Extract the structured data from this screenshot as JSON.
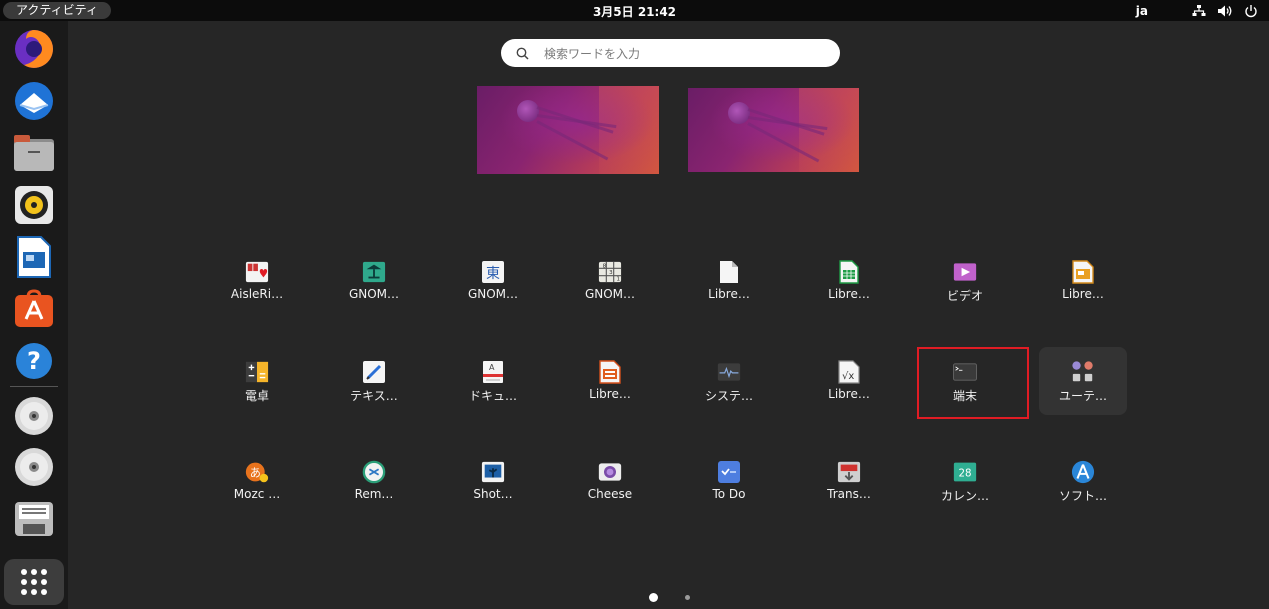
{
  "topbar": {
    "activities": "アクティビティ",
    "clock": "3月5日  21:42",
    "lang": "ja",
    "icons": [
      "network-icon",
      "volume-icon",
      "power-icon"
    ]
  },
  "dock": {
    "items": [
      "firefox",
      "thunderbird",
      "files",
      "rhythmbox",
      "libreoffice-writer",
      "ubuntu-software",
      "help",
      "cd-drive",
      "cd-drive",
      "floppy-drive"
    ],
    "show_apps": "show-apps-icon"
  },
  "search": {
    "placeholder": "検索ワードを入力"
  },
  "workspaces": 2,
  "apps": [
    [
      {
        "name": "AisleRi…",
        "icon": "cards-icon"
      },
      {
        "name": "GNOM…",
        "icon": "mahjongg-icon"
      },
      {
        "name": "GNOM…",
        "icon": "kanji-tile-icon"
      },
      {
        "name": "GNOM…",
        "icon": "sudoku-icon"
      },
      {
        "name": "Libre…",
        "icon": "document-icon"
      },
      {
        "name": "Libre…",
        "icon": "calc-icon"
      },
      {
        "name": "ビデオ",
        "icon": "video-icon"
      },
      {
        "name": "Libre…",
        "icon": "impress-icon"
      }
    ],
    [
      {
        "name": "電卓",
        "icon": "calculator-icon"
      },
      {
        "name": "テキス…",
        "icon": "text-editor-icon"
      },
      {
        "name": "ドキュ…",
        "icon": "document-viewer-icon"
      },
      {
        "name": "Libre…",
        "icon": "impress-icon"
      },
      {
        "name": "システ…",
        "icon": "system-monitor-icon"
      },
      {
        "name": "Libre…",
        "icon": "math-icon"
      },
      {
        "name": "端末",
        "icon": "terminal-icon"
      },
      {
        "name": "ユーテ…",
        "icon": "utilities-folder-icon"
      }
    ],
    [
      {
        "name": "Mozc …",
        "icon": "mozc-icon"
      },
      {
        "name": "Rem…",
        "icon": "remmina-icon"
      },
      {
        "name": "Shot…",
        "icon": "shotwell-icon"
      },
      {
        "name": "Cheese",
        "icon": "cheese-icon"
      },
      {
        "name": "To Do",
        "icon": "todo-icon"
      },
      {
        "name": "Trans…",
        "icon": "transmission-icon"
      },
      {
        "name": "カレン…",
        "icon": "calendar-icon"
      },
      {
        "name": "ソフト…",
        "icon": "software-icon"
      }
    ]
  ],
  "calendar_day": "28",
  "pages": 2,
  "current_page": 1
}
